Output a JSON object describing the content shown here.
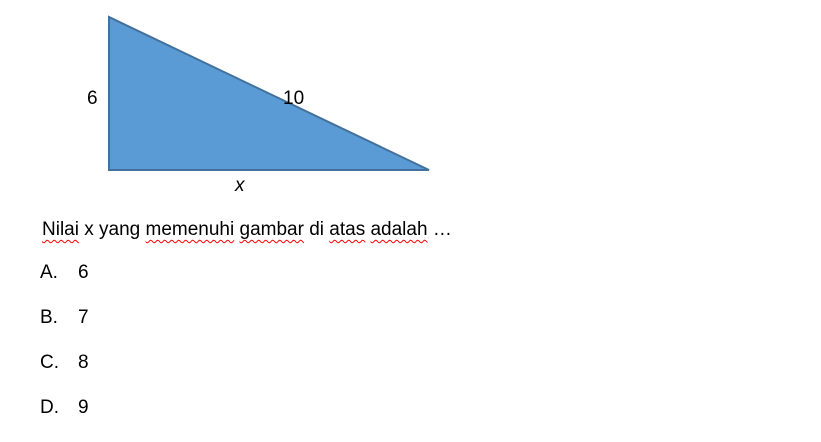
{
  "figure": {
    "left_label": "6",
    "hypotenuse_label": "10",
    "bottom_label": "x",
    "fill_color": "#5b9bd5",
    "stroke_color": "#41719c"
  },
  "question": {
    "parts": [
      "Nilai",
      " x yang ",
      "memenuhi",
      " ",
      "gambar",
      " di ",
      "atas",
      " ",
      "adalah",
      " …"
    ]
  },
  "options": [
    {
      "letter": "A.",
      "value": "6"
    },
    {
      "letter": "B.",
      "value": "7"
    },
    {
      "letter": "C.",
      "value": "8"
    },
    {
      "letter": "D.",
      "value": "9"
    }
  ]
}
